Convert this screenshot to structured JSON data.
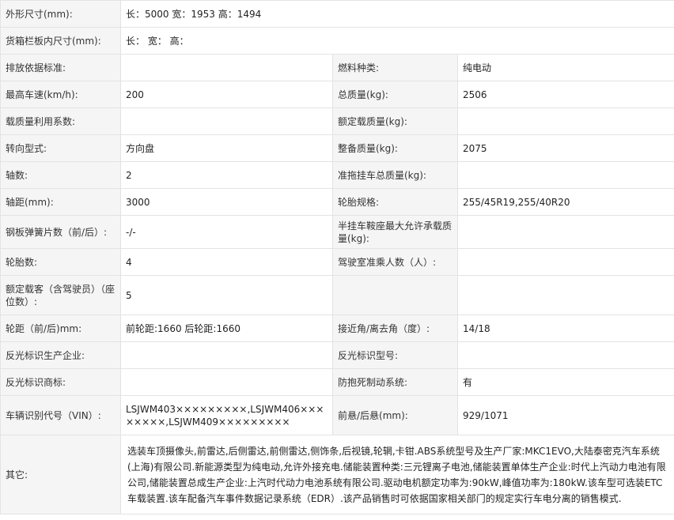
{
  "rows": [
    {
      "l1": "外形尺寸(mm):",
      "v1": "长：5000 宽：1953 高：1494"
    },
    {
      "l1": "货箱栏板内尺寸(mm):",
      "v1": "长： 宽： 高："
    },
    {
      "l1": "排放依据标准:",
      "v1": "",
      "l2": "燃料种类:",
      "v2": "纯电动"
    },
    {
      "l1": "最高车速(km/h):",
      "v1": "200",
      "l2": "总质量(kg):",
      "v2": "2506"
    },
    {
      "l1": "载质量利用系数:",
      "v1": "",
      "l2": "额定载质量(kg):",
      "v2": ""
    },
    {
      "l1": "转向型式:",
      "v1": "方向盘",
      "l2": "整备质量(kg):",
      "v2": "2075"
    },
    {
      "l1": "轴数:",
      "v1": "2",
      "l2": "准拖挂车总质量(kg):",
      "v2": ""
    },
    {
      "l1": "轴距(mm):",
      "v1": "3000",
      "l2": "轮胎规格:",
      "v2": "255/45R19,255/40R20"
    },
    {
      "l1": "钢板弹簧片数（前/后）:",
      "v1": "-/-",
      "l2": "半挂车鞍座最大允许承载质量(kg):",
      "v2": ""
    },
    {
      "l1": "轮胎数:",
      "v1": "4",
      "l2": "驾驶室准乘人数（人）:",
      "v2": ""
    },
    {
      "l1": "额定载客（含驾驶员）（座位数）:",
      "v1": "5",
      "l2": "",
      "v2": ""
    },
    {
      "l1": "轮距（前/后)mm:",
      "v1": "前轮距:1660 后轮距:1660",
      "l2": "接近角/离去角（度）:",
      "v2": "14/18"
    },
    {
      "l1": "反光标识生产企业:",
      "v1": "",
      "l2": "反光标识型号:",
      "v2": ""
    },
    {
      "l1": "反光标识商标:",
      "v1": "",
      "l2": "防抱死制动系统:",
      "v2": "有"
    },
    {
      "l1": "车辆识别代号（VIN）:",
      "v1": "LSJWM403×××××××××,LSJWM406××××××××,LSJWM409×××××××××",
      "l2": "前悬/后悬(mm):",
      "v2": "929/1071"
    }
  ],
  "other": {
    "label": "其它:",
    "text": "选装车顶摄像头,前雷达,后侧雷达,前侧雷达,侧饰条,后视镜,轮辋,卡钳.ABS系统型号及生产厂家:MKC1EVO,大陆泰密克汽车系统(上海)有限公司.新能源类型为纯电动,允许外接充电.储能装置种类:三元锂离子电池,储能装置单体生产企业:时代上汽动力电池有限公司,储能装置总成生产企业:上汽时代动力电池系统有限公司.驱动电机额定功率为:90kW,峰值功率为:180kW.该车型可选装ETC车载装置.该车配备汽车事件数据记录系统（EDR）.该产品销售时可依据国家相关部门的规定实行车电分离的销售模式."
  }
}
